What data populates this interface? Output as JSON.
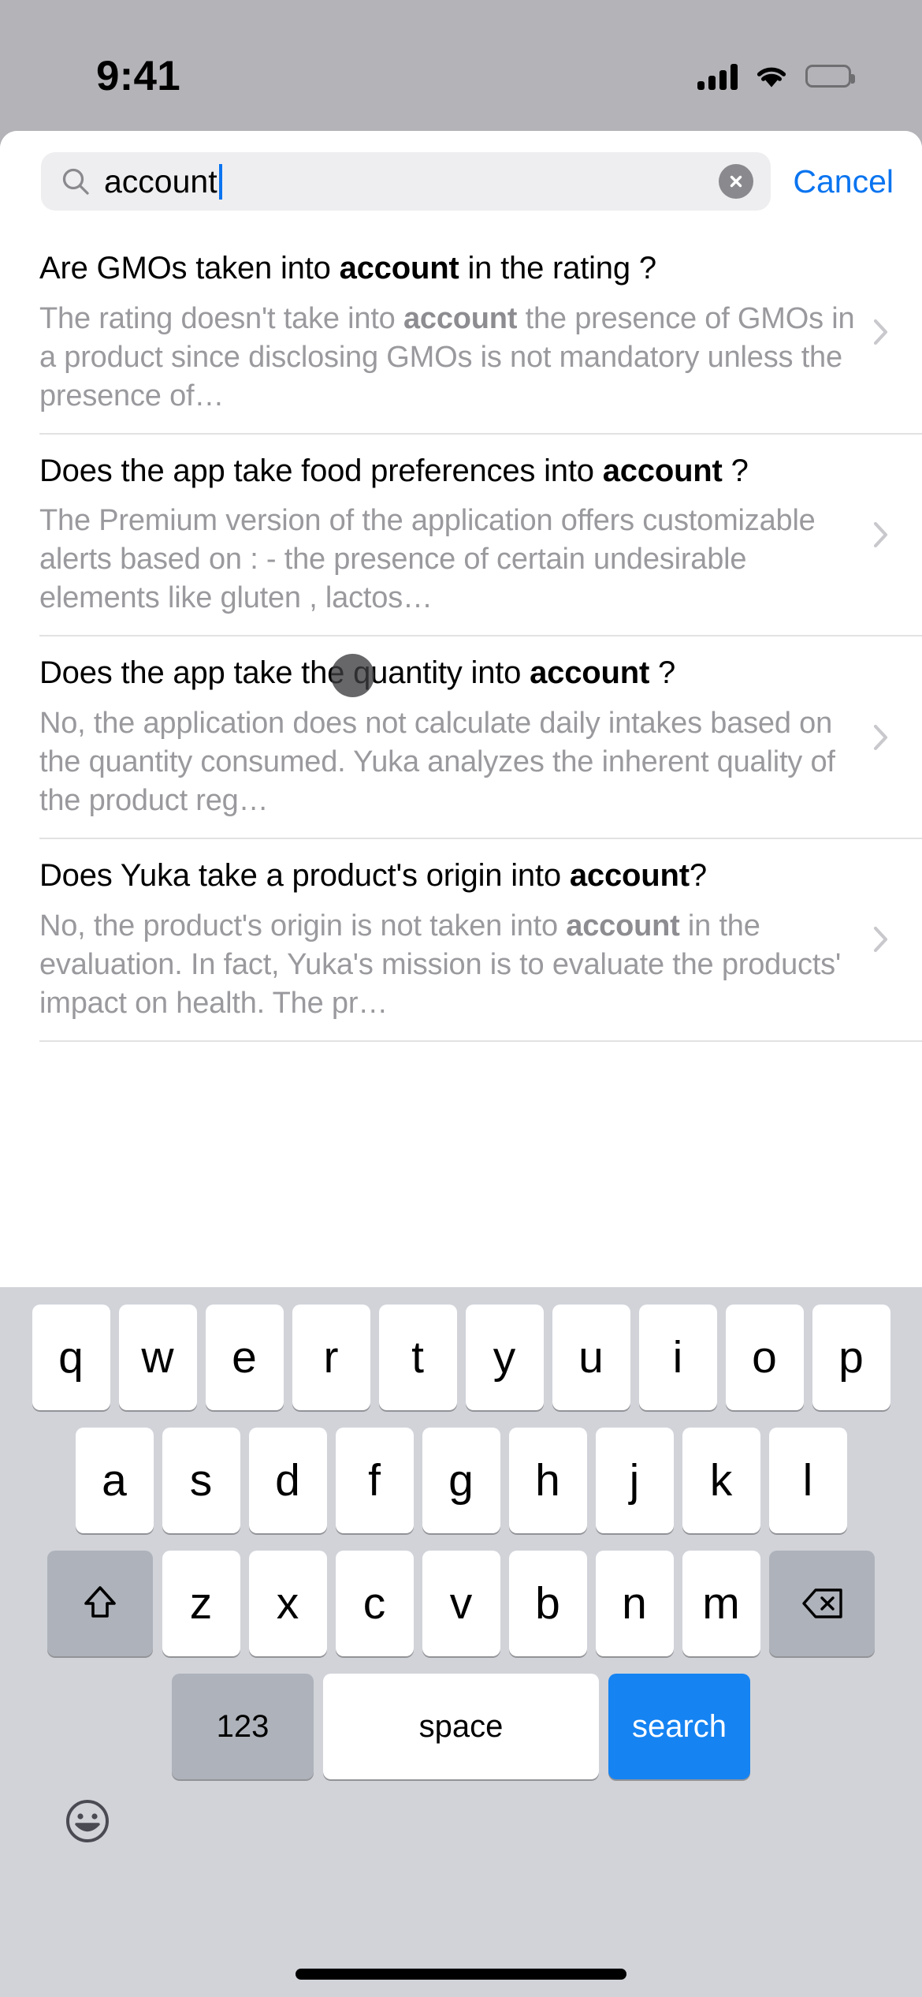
{
  "status_bar": {
    "time": "9:41",
    "cellular_icon": "cellular-signal-icon",
    "wifi_icon": "wifi-icon",
    "battery_icon": "battery-full-icon"
  },
  "search": {
    "value": "account",
    "placeholder": "Search",
    "search_icon": "search-icon",
    "clear_icon": "clear-circle-icon",
    "cancel_label": "Cancel",
    "accent_color": "#0a74f0"
  },
  "results": [
    {
      "title_parts": [
        {
          "text": "Are GMOs taken into ",
          "bold": false
        },
        {
          "text": "account",
          "bold": true
        },
        {
          "text": " in the rating ?",
          "bold": false
        }
      ],
      "snippet_parts": [
        {
          "text": "The rating doesn't take into ",
          "bold": false
        },
        {
          "text": "account",
          "bold": true
        },
        {
          "text": " the presence of GMOs in a product since disclosing GMOs is not mandatory unless the presence of…",
          "bold": false
        }
      ],
      "chevron_icon": "chevron-right-icon"
    },
    {
      "title_parts": [
        {
          "text": "Does the app take food preferences into ",
          "bold": false
        },
        {
          "text": "account",
          "bold": true
        },
        {
          "text": " ?",
          "bold": false
        }
      ],
      "snippet_parts": [
        {
          "text": "The Premium version of the application offers customizable alerts based on : - the presence of certain undesirable elements like gluten , lactos…",
          "bold": false
        }
      ],
      "chevron_icon": "chevron-right-icon"
    },
    {
      "title_parts": [
        {
          "text": "Does the app take the quantity into ",
          "bold": false
        },
        {
          "text": "account",
          "bold": true
        },
        {
          "text": " ?",
          "bold": false
        }
      ],
      "snippet_parts": [
        {
          "text": "No, the application does not calculate daily intakes based on the quantity consumed. Yuka analyzes the inherent quality of the product reg…",
          "bold": false
        }
      ],
      "chevron_icon": "chevron-right-icon"
    },
    {
      "title_parts": [
        {
          "text": "Does Yuka take a product's origin into ",
          "bold": false
        },
        {
          "text": "account",
          "bold": true
        },
        {
          "text": "?",
          "bold": false
        }
      ],
      "snippet_parts": [
        {
          "text": "No, the product's origin is not taken into ",
          "bold": false
        },
        {
          "text": "account",
          "bold": true
        },
        {
          "text": " in the evaluation. In fact, Yuka's mission is to evaluate the products' impact on health. The pr…",
          "bold": false
        }
      ],
      "chevron_icon": "chevron-right-icon"
    }
  ],
  "keyboard": {
    "row1": [
      "q",
      "w",
      "e",
      "r",
      "t",
      "y",
      "u",
      "i",
      "o",
      "p"
    ],
    "row2": [
      "a",
      "s",
      "d",
      "f",
      "g",
      "h",
      "j",
      "k",
      "l"
    ],
    "row3_letters": [
      "z",
      "x",
      "c",
      "v",
      "b",
      "n",
      "m"
    ],
    "shift_icon": "shift-arrow-icon",
    "backspace_icon": "backspace-delete-icon",
    "numeric_label": "123",
    "space_label": "space",
    "search_label": "search",
    "search_key_color": "#1583f2",
    "emoji_icon": "emoji-smiley-icon"
  },
  "home_indicator": "home-indicator-bar"
}
